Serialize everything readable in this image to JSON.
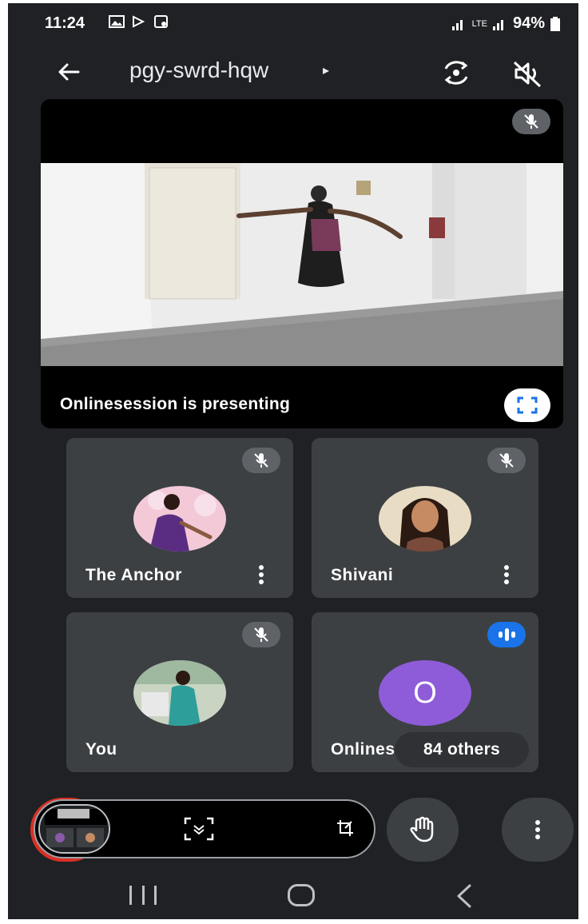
{
  "status_bar": {
    "time": "11:24",
    "battery": "94%",
    "network_label": "LTE"
  },
  "header": {
    "meeting_code": "pgy-swrd-hqw",
    "code_arrow": "▸"
  },
  "presentation": {
    "label": "Onlinesession is presenting"
  },
  "participants": [
    {
      "name": "The Anchor",
      "muted": true
    },
    {
      "name": "Shivani",
      "muted": true
    },
    {
      "name": "You",
      "muted": true
    },
    {
      "name": "Onlinese",
      "avatar_letter": "O",
      "speaking": true
    }
  ],
  "others_chip": "84 others",
  "colors": {
    "background": "#202124",
    "tile": "#3c4043",
    "end_call": "#d93025",
    "speaking": "#1a73e8",
    "avatar_o": "#8e5cd9"
  },
  "icons": {
    "back": "arrow-left-icon",
    "camera_switch": "camera-switch-icon",
    "audio_off": "speaker-off-icon",
    "mic_off": "mic-off-icon",
    "fullscreen": "fullscreen-icon",
    "raise_hand": "hand-icon",
    "more": "more-vert-icon"
  }
}
